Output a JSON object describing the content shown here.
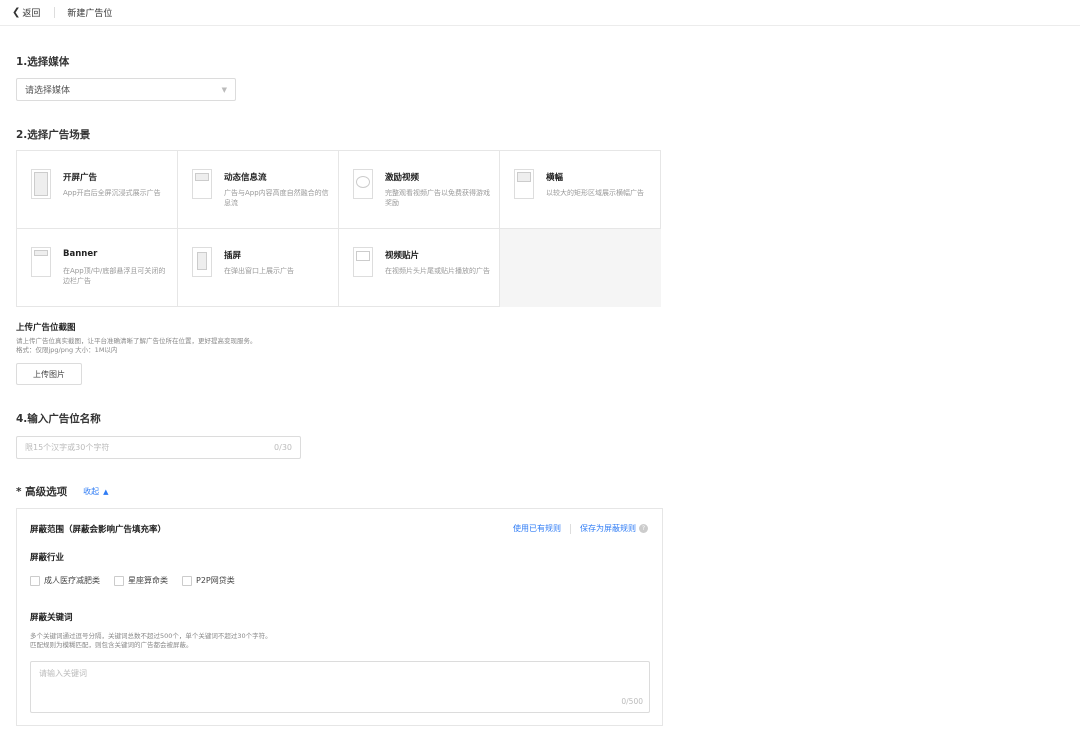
{
  "topbar": {
    "back_label": "返回",
    "page_title": "新建广告位"
  },
  "step1": {
    "title": "1.选择媒体",
    "select_placeholder": "请选择媒体"
  },
  "step2": {
    "title": "2.选择广告场景",
    "scenes": [
      {
        "title": "开屏广告",
        "desc": "App开启后全屏沉浸式展示广告",
        "icon": "splash-icon"
      },
      {
        "title": "动态信息流",
        "desc": "广告与App内容高度自然融合的信息流",
        "icon": "feed-icon"
      },
      {
        "title": "激励视频",
        "desc": "完整观看视频广告以免费获得游戏奖励",
        "icon": "video-icon"
      },
      {
        "title": "横幅",
        "desc": "以较大的矩形区域展示横幅广告",
        "icon": "banner-large-icon"
      },
      {
        "title": "Banner",
        "desc": "在App顶/中/底部悬浮且可关闭的边栏广告",
        "icon": "banner-icon"
      },
      {
        "title": "插屏",
        "desc": "在弹出窗口上展示广告",
        "icon": "interstitial-icon"
      },
      {
        "title": "视频贴片",
        "desc": "在视频片头片尾或贴片播放的广告",
        "icon": "video-patch-icon"
      }
    ]
  },
  "upload": {
    "title": "上传广告位截图",
    "desc_line1": "请上传广告位真实截图，让平台准确清晰了解广告位所在位置，更好提高变现服务。",
    "desc_line2": "格式：仅限jpg/png 大小：1M以内",
    "button": "上传图片"
  },
  "step4": {
    "title": "4.输入广告位名称",
    "placeholder": "限15个汉字或30个字符",
    "counter": "0/30"
  },
  "advanced": {
    "label": "* 高级选项",
    "collapse": "收起",
    "panel": {
      "title": "屏蔽范围（屏蔽会影响广告填充率）",
      "link_use": "使用已有规则",
      "link_save": "保存为屏蔽规则",
      "industry_title": "屏蔽行业",
      "industries": [
        "成人医疗减肥类",
        "星座算命类",
        "P2P网贷类"
      ],
      "keyword_title": "屏蔽关键词",
      "keyword_desc1": "多个关键词通过逗号分隔，关键词总数不超过500个，单个关键词不超过30个字符。",
      "keyword_desc2": "匹配规则为模糊匹配，则包含关键词的广告都会被屏蔽。",
      "keyword_placeholder": "请输入关键词",
      "keyword_counter": "0/500"
    }
  },
  "colors": {
    "link": "#2f7cf5",
    "border": "#e6e6e6"
  }
}
